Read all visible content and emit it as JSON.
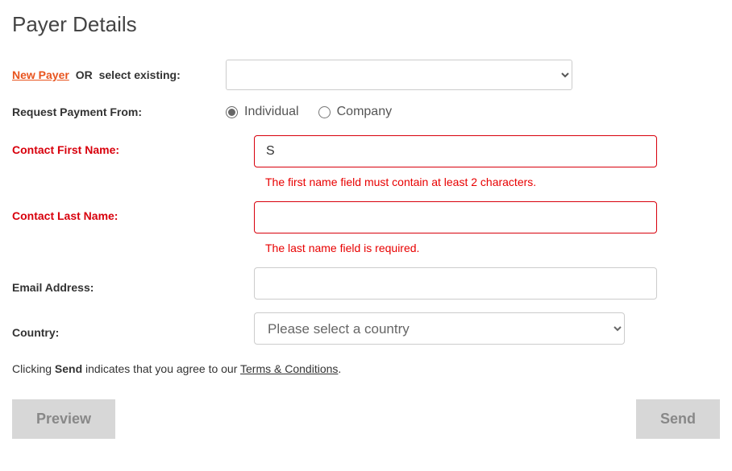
{
  "title": "Payer Details",
  "header": {
    "new_payer": "New Payer",
    "or": "OR",
    "select_existing": "select existing:"
  },
  "existing_select": {
    "value": ""
  },
  "request_from": {
    "label": "Request Payment From:",
    "options": {
      "individual": "Individual",
      "company": "Company"
    },
    "selected": "individual"
  },
  "fields": {
    "first_name": {
      "label": "Contact First Name:",
      "value": "S",
      "error": "The first name field must contain at least 2 characters."
    },
    "last_name": {
      "label": "Contact Last Name:",
      "value": "",
      "error": "The last name field is required."
    },
    "email": {
      "label": "Email Address:",
      "value": ""
    },
    "country": {
      "label": "Country:",
      "placeholder": "Please select a country"
    }
  },
  "terms": {
    "prefix": "Clicking ",
    "send_word": "Send",
    "middle": " indicates that you agree to our ",
    "link": "Terms & Conditions",
    "suffix": "."
  },
  "buttons": {
    "preview": "Preview",
    "send": "Send"
  }
}
